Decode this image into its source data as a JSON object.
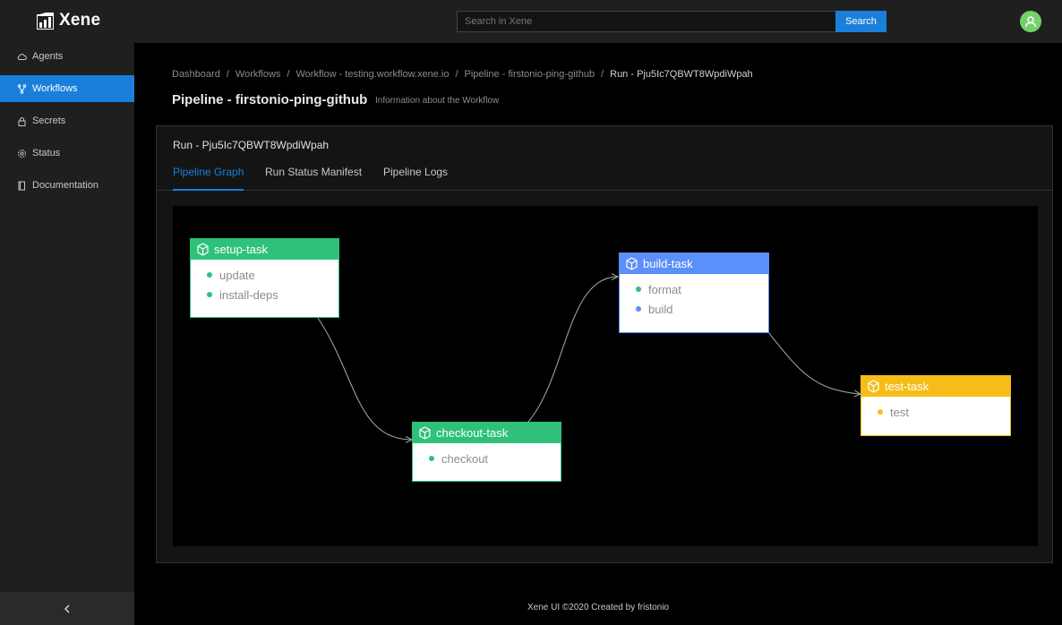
{
  "app": {
    "name": "Xene"
  },
  "search": {
    "placeholder": "Search in Xene",
    "button_label": "Search"
  },
  "sidebar": {
    "items": [
      {
        "label": "Agents",
        "icon": "cloud-icon",
        "active": false
      },
      {
        "label": "Workflows",
        "icon": "branch-icon",
        "active": true
      },
      {
        "label": "Secrets",
        "icon": "lock-icon",
        "active": false
      },
      {
        "label": "Status",
        "icon": "gear-icon",
        "active": false
      },
      {
        "label": "Documentation",
        "icon": "book-icon",
        "active": false
      }
    ]
  },
  "breadcrumb": [
    "Dashboard",
    "Workflows",
    "Workflow - testing.workflow.xene.io",
    "Pipeline - firstonio-ping-github",
    "Run - Pju5Ic7QBWT8WpdiWpah"
  ],
  "page": {
    "title": "Pipeline - firstonio-ping-github",
    "subtitle": "Information about the Workflow"
  },
  "run": {
    "title": "Run - Pju5Ic7QBWT8WpdiWpah"
  },
  "tabs": [
    {
      "label": "Pipeline Graph",
      "active": true
    },
    {
      "label": "Run Status Manifest",
      "active": false
    },
    {
      "label": "Pipeline Logs",
      "active": false
    }
  ],
  "graph": {
    "nodes": [
      {
        "name": "setup-task",
        "color": "#2fc17a",
        "steps": [
          {
            "label": "update",
            "color": "#2fc17a"
          },
          {
            "label": "install-deps",
            "color": "#2fc17a"
          }
        ]
      },
      {
        "name": "checkout-task",
        "color": "#2fc17a",
        "steps": [
          {
            "label": "checkout",
            "color": "#2fc17a"
          }
        ]
      },
      {
        "name": "build-task",
        "color": "#5b8ff9",
        "steps": [
          {
            "label": "format",
            "color": "#2fc17a"
          },
          {
            "label": "build",
            "color": "#5b8ff9"
          }
        ]
      },
      {
        "name": "test-task",
        "color": "#f5bd18",
        "steps": [
          {
            "label": "test",
            "color": "#f5bd18"
          }
        ]
      }
    ],
    "edges": [
      [
        "setup-task",
        "checkout-task"
      ],
      [
        "checkout-task",
        "build-task"
      ],
      [
        "build-task",
        "test-task"
      ]
    ]
  },
  "footer": {
    "text": "Xene UI ©2020 Created by fristonio"
  }
}
